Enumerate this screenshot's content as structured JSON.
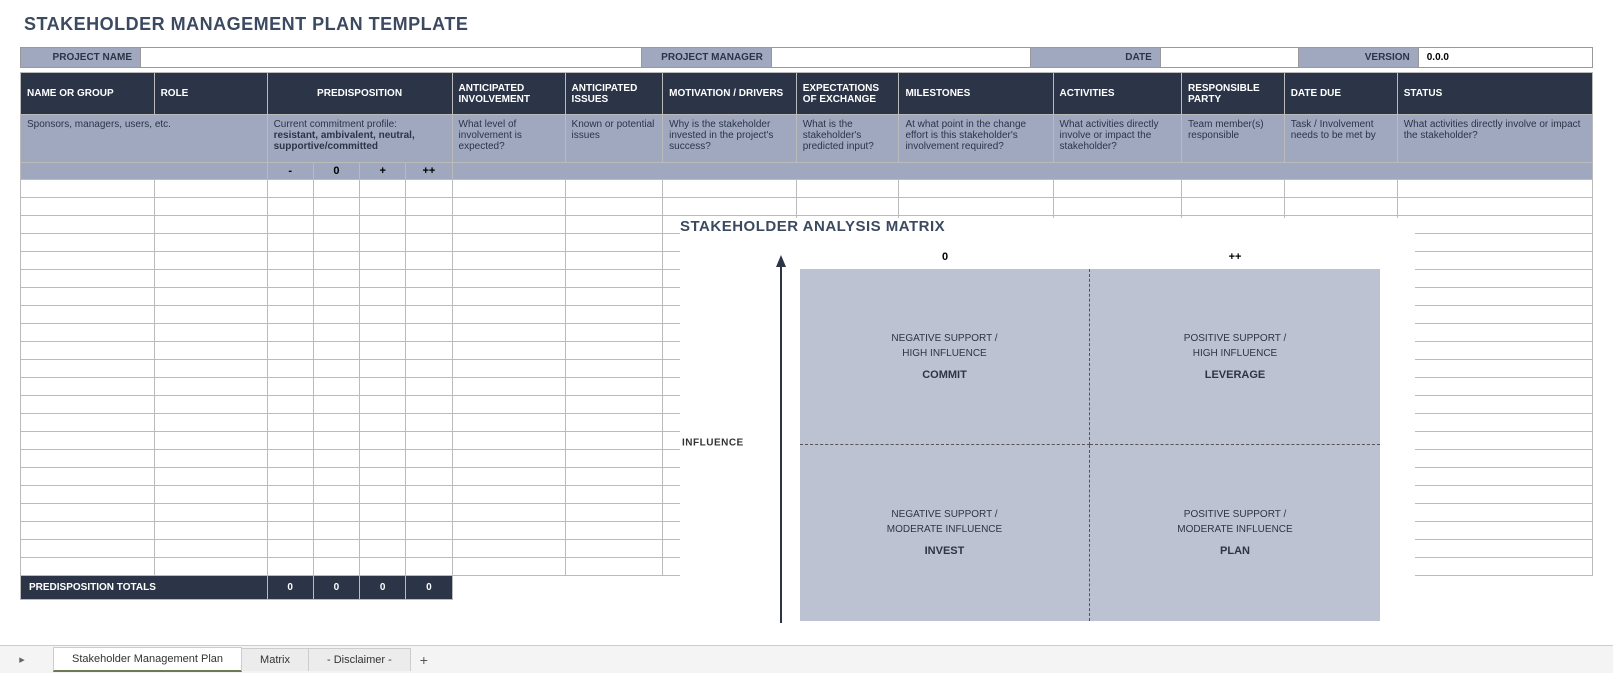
{
  "title": "STAKEHOLDER MANAGEMENT PLAN TEMPLATE",
  "info": {
    "project_name_label": "PROJECT NAME",
    "project_name_value": "",
    "project_manager_label": "PROJECT MANAGER",
    "project_manager_value": "",
    "date_label": "DATE",
    "date_value": "",
    "version_label": "VERSION",
    "version_value": "0.0.0"
  },
  "columns": {
    "name": "NAME OR GROUP",
    "role": "ROLE",
    "predisposition": "PREDISPOSITION",
    "involvement": "ANTICIPATED INVOLVEMENT",
    "issues": "ANTICIPATED ISSUES",
    "motivation": "MOTIVATION / DRIVERS",
    "expectations": "EXPECTATIONS OF EXCHANGE",
    "milestones": "MILESTONES",
    "activities": "ACTIVITIES",
    "responsible": "RESPONSIBLE PARTY",
    "due": "DATE DUE",
    "status": "STATUS"
  },
  "hints": {
    "name": "Sponsors, managers, users, etc.",
    "predisposition_line1": "Current commitment profile:",
    "predisposition_line2": "resistant, ambivalent, neutral, supportive/committed",
    "involvement": "What level of involvement is expected?",
    "issues": "Known or potential issues",
    "motivation": "Why is the stakeholder invested in the project's success?",
    "expectations": "What is the stakeholder's predicted input?",
    "milestones": "At what point in the change effort is this stakeholder's involvement required?",
    "activities": "What activities directly involve or impact the stakeholder?",
    "responsible": "Team member(s) responsible",
    "due": "Task / Involvement needs to be met by",
    "status": "What activities directly involve or impact the stakeholder?"
  },
  "predis_cols": {
    "c1": "-",
    "c2": "0",
    "c3": "+",
    "c4": "++"
  },
  "totals": {
    "label": "PREDISPOSITION TOTALS",
    "v1": "0",
    "v2": "0",
    "v3": "0",
    "v4": "0"
  },
  "matrix": {
    "title": "STAKEHOLDER ANALYSIS MATRIX",
    "y_axis": "INFLUENCE",
    "col1": "0",
    "col2": "++",
    "q1": {
      "l1": "NEGATIVE SUPPORT /",
      "l2": "HIGH INFLUENCE",
      "l3": "COMMIT"
    },
    "q2": {
      "l1": "POSITIVE SUPPORT /",
      "l2": "HIGH INFLUENCE",
      "l3": "LEVERAGE"
    },
    "q3": {
      "l1": "NEGATIVE SUPPORT /",
      "l2": "MODERATE INFLUENCE",
      "l3": "INVEST"
    },
    "q4": {
      "l1": "POSITIVE SUPPORT /",
      "l2": "MODERATE INFLUENCE",
      "l3": "PLAN"
    }
  },
  "tabs": {
    "t1": "Stakeholder Management Plan",
    "t2": "Matrix",
    "t3": "- Disclaimer -"
  }
}
